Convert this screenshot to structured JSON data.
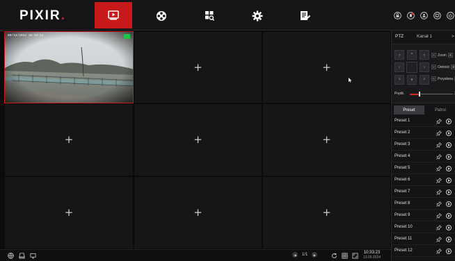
{
  "brand": {
    "logo_text": "PIXIR",
    "logo_dot": ".",
    "accent": "#c81a1a"
  },
  "nav": {
    "tabs": [
      {
        "icon": "playback-icon",
        "active": true
      },
      {
        "icon": "film-reel-icon",
        "active": false
      },
      {
        "icon": "file-search-icon",
        "active": false
      },
      {
        "icon": "gear-icon",
        "active": false
      },
      {
        "icon": "log-edit-icon",
        "active": false
      }
    ],
    "right_icons": [
      "lock-icon",
      "alarm-icon",
      "user-icon",
      "screen-icon",
      "power-icon"
    ]
  },
  "grid": {
    "layout": "3x3",
    "camera_osd": "09/13/2024 10:33:21",
    "empty_symbol": "+"
  },
  "bottom_bar": {
    "left_icons": [
      "network-icon",
      "hdd-icon",
      "monitor-icon"
    ],
    "page": "1/1",
    "right_icons": [
      "refresh-icon",
      "grid-icon",
      "fullscreen-icon"
    ],
    "time": "10:33:23",
    "date": "13.09.2024"
  },
  "ptz": {
    "title": "PTZ",
    "channel": "Kanał 1",
    "collapse_arrow": ">",
    "zoom_label": "Zoom",
    "focus_label": "Ostrość",
    "iris_label": "Przysłona",
    "speed_label": "Prędk.",
    "speed_value": "2",
    "speed_fraction": 0.22,
    "tabs": [
      "Preset",
      "Patrol"
    ],
    "active_tab": "Preset",
    "presets": [
      "Preset 1",
      "Preset 2",
      "Preset 3",
      "Preset 4",
      "Preset 5",
      "Preset 6",
      "Preset 7",
      "Preset 8",
      "Preset 9",
      "Preset 10",
      "Preset 11",
      "Preset 12"
    ]
  }
}
